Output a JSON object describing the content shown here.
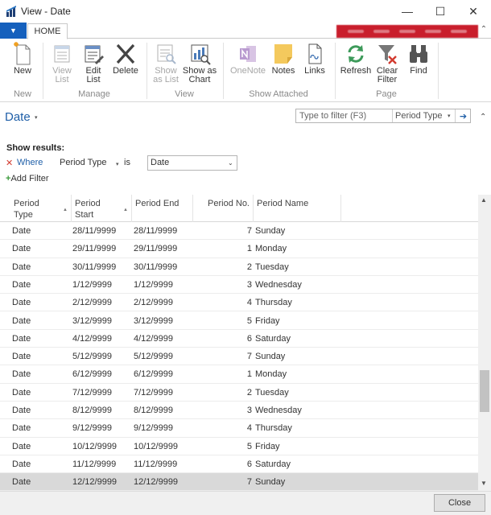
{
  "window": {
    "title": "View - Date",
    "minimize_glyph": "—",
    "maximize_glyph": "☐",
    "close_glyph": "✕"
  },
  "tabs": {
    "app_menu_glyph": "▼",
    "home": "HOME",
    "collapse_glyph": "⌃"
  },
  "ribbon": {
    "new": "New",
    "view_list": [
      "View",
      "List"
    ],
    "edit_list": [
      "Edit",
      "List"
    ],
    "delete": "Delete",
    "show_as_list": [
      "Show",
      "as List"
    ],
    "show_as_chart": [
      "Show as",
      "Chart"
    ],
    "onenote": "OneNote",
    "notes": "Notes",
    "links": "Links",
    "refresh": "Refresh",
    "clear_filter": [
      "Clear",
      "Filter"
    ],
    "find": "Find",
    "groups": {
      "new": "New",
      "manage": "Manage",
      "view": "View",
      "show_attached": "Show Attached",
      "page": "Page"
    }
  },
  "page": {
    "title": "Date",
    "title_caret": "▾",
    "filter_placeholder": "Type to filter (F3)",
    "filter_field": "Period Type",
    "filter_field_caret": "▾",
    "filter_go": "➔",
    "collapse_glyph": "⌃",
    "show_results": "Show results:",
    "where_remove": "✕",
    "where": "Where",
    "where_field": "Period Type",
    "where_field_caret": "▾",
    "where_op": "is",
    "where_value": "Date",
    "where_value_caret": "⌄",
    "add_filter_plus": "+",
    "add_filter": "Add Filter"
  },
  "grid": {
    "headers": {
      "period_type": [
        "Period",
        "Type"
      ],
      "period_start": [
        "Period",
        "Start"
      ],
      "period_end": "Period End",
      "period_no": "Period No.",
      "period_name": "Period Name",
      "sort_glyph": "▲"
    },
    "rows": [
      {
        "type": "Date",
        "start": "28/11/9999",
        "end": "28/11/9999",
        "no": "7",
        "name": "Sunday"
      },
      {
        "type": "Date",
        "start": "29/11/9999",
        "end": "29/11/9999",
        "no": "1",
        "name": "Monday"
      },
      {
        "type": "Date",
        "start": "30/11/9999",
        "end": "30/11/9999",
        "no": "2",
        "name": "Tuesday"
      },
      {
        "type": "Date",
        "start": "1/12/9999",
        "end": "1/12/9999",
        "no": "3",
        "name": "Wednesday"
      },
      {
        "type": "Date",
        "start": "2/12/9999",
        "end": "2/12/9999",
        "no": "4",
        "name": "Thursday"
      },
      {
        "type": "Date",
        "start": "3/12/9999",
        "end": "3/12/9999",
        "no": "5",
        "name": "Friday"
      },
      {
        "type": "Date",
        "start": "4/12/9999",
        "end": "4/12/9999",
        "no": "6",
        "name": "Saturday"
      },
      {
        "type": "Date",
        "start": "5/12/9999",
        "end": "5/12/9999",
        "no": "7",
        "name": "Sunday"
      },
      {
        "type": "Date",
        "start": "6/12/9999",
        "end": "6/12/9999",
        "no": "1",
        "name": "Monday"
      },
      {
        "type": "Date",
        "start": "7/12/9999",
        "end": "7/12/9999",
        "no": "2",
        "name": "Tuesday"
      },
      {
        "type": "Date",
        "start": "8/12/9999",
        "end": "8/12/9999",
        "no": "3",
        "name": "Wednesday"
      },
      {
        "type": "Date",
        "start": "9/12/9999",
        "end": "9/12/9999",
        "no": "4",
        "name": "Thursday"
      },
      {
        "type": "Date",
        "start": "10/12/9999",
        "end": "10/12/9999",
        "no": "5",
        "name": "Friday"
      },
      {
        "type": "Date",
        "start": "11/12/9999",
        "end": "11/12/9999",
        "no": "6",
        "name": "Saturday"
      },
      {
        "type": "Date",
        "start": "12/12/9999",
        "end": "12/12/9999",
        "no": "7",
        "name": "Sunday"
      }
    ],
    "selected_row_index": 14
  },
  "scrollbar": {
    "up_glyph": "▲",
    "down_glyph": "▼"
  },
  "footer": {
    "close": "Close"
  },
  "colors": {
    "accent": "#1f5fa8",
    "app_menu": "#1560bd",
    "redacted_bar": "#c91e2c",
    "where_remove": "#d23a2f",
    "add_plus": "#3a9a3a"
  },
  "icons": {
    "app": "nav-app-icon",
    "new": "new-document-icon",
    "view_list": "view-list-icon",
    "edit_list": "edit-list-icon",
    "delete": "delete-x-icon",
    "show_as_list": "show-as-list-icon",
    "show_as_chart": "show-as-chart-icon",
    "onenote": "onenote-icon",
    "notes": "notes-icon",
    "links": "links-icon",
    "refresh": "refresh-icon",
    "clear_filter": "clear-filter-icon",
    "find": "binoculars-icon"
  }
}
